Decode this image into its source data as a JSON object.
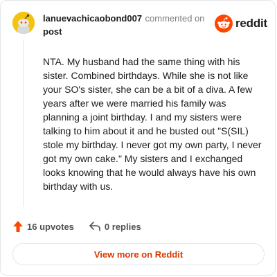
{
  "comment": {
    "username": "lanuevachicaobond007",
    "action_text": "commented on",
    "post_link": "post",
    "body": "NTA. My husband had the same thing with his sister. Combined birthdays. While she is not like your SO's sister, she can be a bit of a diva. A few years after we were married his family was planning a joint birthday. I and my sisters were talking to him about it and he busted out \"S(SIL) stole my birthday. I never got my own party, I never got my own cake.\" My sisters and I exchanged looks knowing that he would always have his own birthday with us.",
    "upvotes_label": "16 upvotes",
    "replies_label": "0 replies"
  },
  "brand": {
    "wordmark": "reddit",
    "logo_icon": "reddit-snoo-icon",
    "accent_color": "#ff4500"
  },
  "footer": {
    "view_button_label": "View more on Reddit"
  },
  "icons": {
    "avatar": "snoo-avatar-icon",
    "upvote": "upvote-arrow-icon",
    "reply": "reply-arrow-icon"
  }
}
